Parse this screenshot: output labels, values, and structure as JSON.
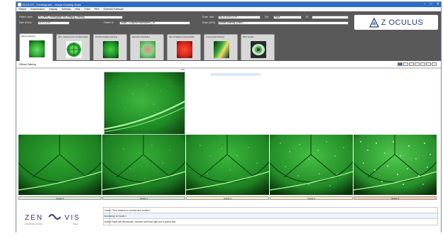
{
  "window": {
    "title": "OCULUS - Keratograph - Image Grading Scale",
    "min": "–",
    "max": "□",
    "close": "✕"
  },
  "menu": [
    "Patient",
    "Examination",
    "Display",
    "Settings",
    "Help",
    "Print",
    "PES",
    "External Software"
  ],
  "patient": {
    "name_label": "Patient name",
    "name_value": "M_Demo_Keratograph 5M_Imaging_Staining",
    "dob_label": "Date of birth",
    "dob_value": "01.01.2019",
    "id_label": "Patient ID",
    "id_value": "Staple / Conjunct examination_JR",
    "exam_label": "Exam. date",
    "exam_value": "04.10.2019 11:39",
    "eye_label": "Eye",
    "eye_value": "Right",
    "od_label": "OD",
    "scale_label": "Scale (ODS)",
    "scale_value": "Diffuse Staining Grade 1"
  },
  "logo": {
    "brand": "Z OCULUS",
    "mark": "®"
  },
  "tabs": [
    {
      "label": "Diffuse Staining",
      "thumb": "diffuse"
    },
    {
      "label": "NEI - National Inst. Contact staining",
      "thumb": "nei"
    },
    {
      "label": "CCLRU Grading Staining",
      "thumb": "cclru"
    },
    {
      "label": "Vascular Indentation",
      "thumb": "vascular"
    },
    {
      "label": "Sport Papillary Conjunctivitis",
      "thumb": "papillary"
    },
    {
      "label": "Conjunctival Staining",
      "thumb": "conjunctival"
    },
    {
      "label": "Blink Quality",
      "thumb": "blink"
    }
  ],
  "content": {
    "title": "Diffuse Staining",
    "side_tag": "Left"
  },
  "grades": [
    {
      "label": "Grade 0",
      "color": "#d8efd0"
    },
    {
      "label": "Grade 1",
      "color": "#d8efd0"
    },
    {
      "label": "Grade 2",
      "color": "#f8f1c8"
    },
    {
      "label": "Grade 3",
      "color": "#f8f1c8"
    },
    {
      "label": "Grade 4",
      "color": "#f7c9a8"
    }
  ],
  "info_rows": [
    {
      "key": "Cause:",
      "value": "Toxic reaction to contact lens solution"
    },
    {
      "key": "Normal:",
      "value": "Up to Grade 1"
    },
    {
      "key": "Advice:",
      "value": "Stain with fluorescein, examine with blue light and a yellow filter"
    }
  ],
  "zenvision": {
    "zen": "ZEN",
    "vis": "VIS",
    "sub1": "VISION SOLUTIONS",
    "sub2": "Vision"
  },
  "colors": {
    "titlebar": "#2b6cc4",
    "header": "#595959",
    "stain_green": "#2fb82f"
  }
}
